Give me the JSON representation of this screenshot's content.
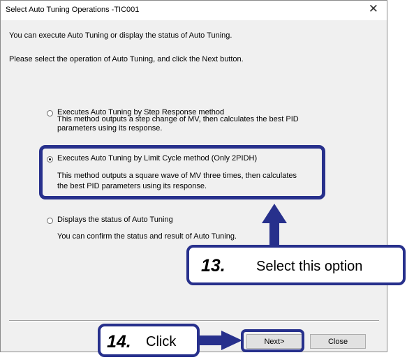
{
  "dialog": {
    "title": "Select Auto Tuning Operations -TIC001",
    "close_glyph": "✕",
    "intro_line_1": "You can execute Auto Tuning or display the status of Auto Tuning.",
    "intro_line_2": "Please select the operation of Auto Tuning, and click the Next button.",
    "options": [
      {
        "label": "Executes Auto Tuning by Step Response method",
        "desc_1": "This method outputs a step change of MV, then calculates the best PID",
        "desc_2": "parameters using its response.",
        "selected": false
      },
      {
        "label": "Executes Auto Tuning by Limit Cycle method (Only 2PIDH)",
        "desc_1": "This method outputs a square wave of MV three times, then calculates",
        "desc_2": "the best PID parameters using its response.",
        "selected": true
      },
      {
        "label": "Displays the status of Auto Tuning",
        "desc_1": "You can confirm the status and result of Auto Tuning.",
        "selected": false
      }
    ],
    "buttons": {
      "next": "Next>",
      "close": "Close"
    }
  },
  "annotations": {
    "step13_number": "13.",
    "step13_text": "Select this option",
    "step14_number": "14.",
    "step14_text": "Click",
    "accent_color": "#27308c"
  }
}
